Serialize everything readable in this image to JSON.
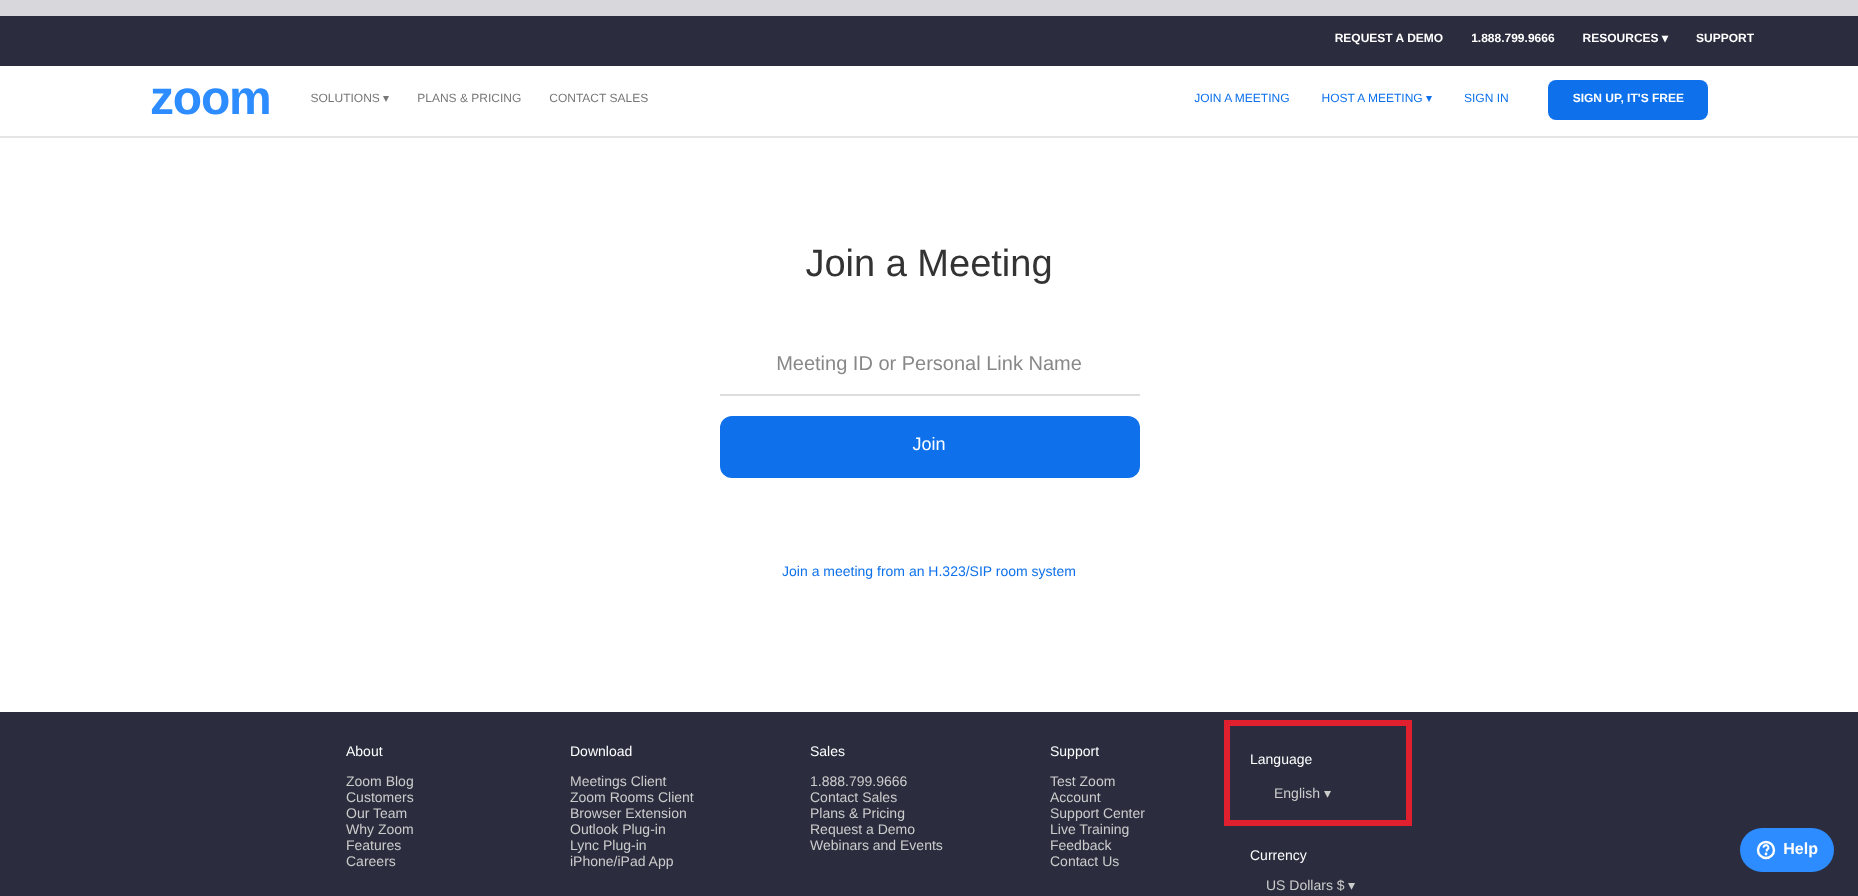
{
  "top_bar": {
    "links": [
      "REQUEST A DEMO",
      "1.888.799.9666",
      "RESOURCES ▾",
      "SUPPORT"
    ]
  },
  "nav": {
    "logo": "zoom",
    "left_links": [
      "SOLUTIONS ▾",
      "PLANS & PRICING",
      "CONTACT SALES"
    ],
    "right_links": [
      "JOIN A MEETING",
      "HOST A MEETING ▾",
      "SIGN IN"
    ],
    "signup_button": "SIGN UP, IT'S FREE"
  },
  "main": {
    "title": "Join a Meeting",
    "meeting_field": {
      "placeholder": "Meeting ID or Personal Link Name"
    },
    "join_button": "Join",
    "room_link": "Join a meeting from an H.323/SIP room system"
  },
  "footer": {
    "columns": [
      {
        "heading": "About",
        "links": [
          "Zoom Blog",
          "Customers",
          "Our Team",
          "Why Zoom",
          "Features",
          "Careers"
        ]
      },
      {
        "heading": "Download",
        "links": [
          "Meetings Client",
          "Zoom Rooms Client",
          "Browser Extension",
          "Outlook Plug-in",
          "Lync Plug-in",
          "iPhone/iPad App"
        ]
      },
      {
        "heading": "Sales",
        "links": [
          "1.888.799.9666",
          "Contact Sales",
          "Plans & Pricing",
          "Request a Demo",
          "Webinars and Events"
        ]
      },
      {
        "heading": "Support",
        "links": [
          "Test Zoom",
          "Account",
          "Support Center",
          "Live Training",
          "Feedback",
          "Contact Us"
        ]
      }
    ],
    "language": {
      "heading": "Language",
      "value": "English ▾",
      "highlighted": true
    },
    "currency": {
      "heading": "Currency",
      "value": "US Dollars $ ▾"
    },
    "help_button": "Help"
  }
}
